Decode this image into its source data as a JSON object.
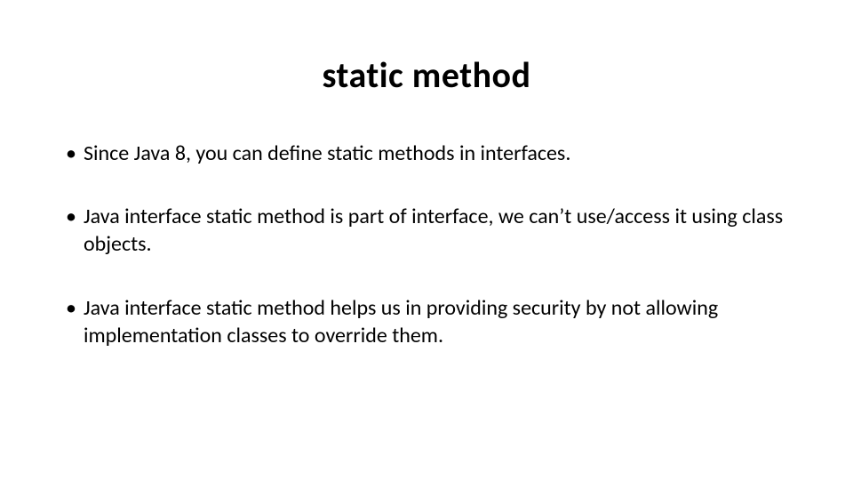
{
  "slide": {
    "title": "static method",
    "bullets": [
      "Since Java 8, you can define static methods in interfaces.",
      "Java interface static method is part of interface, we can’t use/access it using class objects.",
      "Java interface static method helps us in providing security by not allowing implementation classes to override them."
    ]
  }
}
